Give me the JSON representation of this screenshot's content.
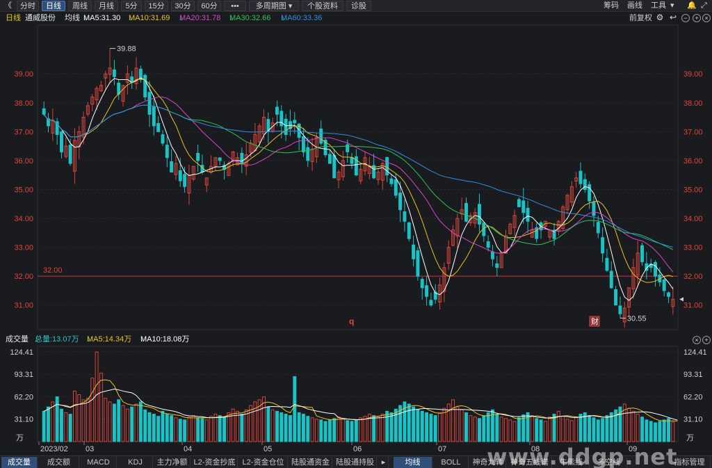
{
  "toolbar": {
    "back_icon": "《",
    "items": [
      "分时",
      "日线",
      "周线",
      "月线",
      "5分",
      "15分",
      "30分",
      "60分",
      "•••",
      "多周期图",
      "个股资料",
      "诊股"
    ],
    "active": "日线",
    "right": [
      "筹码",
      "画线",
      "工具"
    ],
    "dropdown_icon": "chevron-down-icon"
  },
  "legend": {
    "period": "日线",
    "name": "通威股份",
    "indicator": "均线",
    "ma5": "MA5:31.30",
    "ma10": "MA10:31.69",
    "ma20": "MA20:31.78",
    "ma30": "MA30:32.66",
    "ma60": "MA60:33.36",
    "adjust": "前复权",
    "arrow": "↓"
  },
  "colors": {
    "up": "#d9453a",
    "down": "#19c3c6",
    "ma5": "#ffffff",
    "ma10": "#e8c31f",
    "ma20": "#d846c8",
    "ma30": "#2ac45a",
    "ma60": "#2f8fe0",
    "grid": "#2c2d32",
    "axis_text": "#e0453a",
    "hline": "#c83a3a"
  },
  "price_axis": {
    "ticks": [
      "39.00",
      "38.00",
      "37.00",
      "36.00",
      "35.00",
      "34.00",
      "33.00",
      "32.00",
      "31.00"
    ],
    "min": 30.2,
    "max": 40.4
  },
  "annotations": {
    "high_label": "39.88",
    "low_label": "30.55",
    "hline_label": "32.00",
    "marker_q": "q",
    "marker_cai": "财"
  },
  "volume_legend": {
    "title": "成交量",
    "total": "总量:13.07万",
    "ma5": "MA5:14.34万",
    "ma10": "MA10:18.08万",
    "arrow": "↓"
  },
  "volume_axis": {
    "ticks": [
      "124.41",
      "93.31",
      "62.20",
      "31.10"
    ],
    "unit": "万",
    "max": 130
  },
  "date_axis": {
    "labels": [
      "2023/02",
      "03",
      "04",
      "05",
      "06",
      "07",
      "08",
      "09"
    ]
  },
  "bottom_tabs": {
    "left": [
      "成交量",
      "成交额",
      "MACD",
      "KDJ",
      "主力净额",
      "L2-资金抄底",
      "L2-资金仓位",
      "陆股通资金",
      "陆股通持股"
    ],
    "right": [
      "均线",
      "BOLL",
      "神奇九转",
      "神奇五线谱",
      "牛熊线",
      "多空线"
    ],
    "end": "指标管理",
    "active_left": "成交量",
    "active_right": "均线"
  },
  "watermark": "www.ddgp.net",
  "chart_data": {
    "type": "candlestick",
    "title": "通威股份 日线",
    "x_range": [
      "2023/02",
      "2023/09"
    ],
    "y_range": [
      30.55,
      39.88
    ],
    "price_high": 39.88,
    "price_low": 30.55,
    "last_close": 31.2,
    "moving_averages": {
      "MA5": 31.3,
      "MA10": 31.69,
      "MA20": 31.78,
      "MA30": 32.66,
      "MA60": 33.36
    },
    "volume": {
      "unit": "万",
      "total": 13.07,
      "MA5": 14.34,
      "MA10": 18.08
    },
    "closes_approx": [
      37.6,
      37.2,
      37.4,
      36.9,
      36.3,
      36.5,
      35.9,
      36.7,
      37.0,
      37.5,
      37.9,
      38.2,
      38.5,
      38.6,
      39.0,
      39.2,
      38.9,
      38.3,
      38.6,
      39.0,
      38.7,
      39.2,
      38.8,
      38.2,
      37.6,
      37.2,
      37.0,
      36.6,
      36.1,
      35.6,
      35.9,
      35.3,
      35.1,
      35.5,
      35.8,
      36.0,
      35.6,
      35.4,
      35.8,
      36.1,
      36.0,
      35.7,
      35.9,
      36.3,
      36.1,
      35.9,
      36.2,
      36.6,
      36.9,
      37.2,
      37.5,
      37.0,
      37.3,
      37.6,
      37.2,
      36.9,
      37.1,
      37.3,
      36.8,
      36.3,
      36.0,
      36.4,
      36.8,
      36.6,
      36.2,
      35.9,
      35.4,
      35.6,
      36.0,
      36.3,
      35.9,
      35.5,
      35.7,
      36.1,
      35.8,
      35.4,
      35.6,
      35.9,
      35.5,
      35.2,
      34.8,
      34.3,
      33.9,
      33.3,
      32.6,
      32.0,
      31.6,
      31.3,
      31.0,
      31.2,
      31.7,
      32.3,
      33.0,
      33.6,
      34.0,
      34.3,
      33.9,
      34.1,
      34.2,
      33.8,
      33.4,
      33.0,
      32.6,
      32.3,
      32.8,
      33.4,
      33.8,
      34.1,
      34.4,
      34.2,
      33.9,
      33.6,
      33.3,
      33.6,
      33.9,
      33.6,
      33.3,
      33.9,
      34.4,
      34.8,
      35.1,
      35.4,
      35.2,
      35.0,
      34.6,
      34.1,
      33.5,
      32.8,
      32.2,
      31.6,
      31.0,
      30.7,
      30.9,
      31.6,
      32.3,
      32.8,
      32.5,
      32.2,
      32.3,
      32.0,
      31.8,
      31.5,
      31.3,
      31.2
    ],
    "volume_approx": [
      42,
      48,
      55,
      62,
      45,
      40,
      38,
      70,
      65,
      58,
      60,
      88,
      124,
      95,
      60,
      55,
      52,
      58,
      50,
      45,
      48,
      52,
      55,
      44,
      40,
      38,
      35,
      42,
      38,
      36,
      33,
      31,
      30,
      34,
      36,
      33,
      32,
      30,
      35,
      38,
      36,
      34,
      40,
      45,
      42,
      38,
      44,
      50,
      55,
      58,
      62,
      48,
      44,
      42,
      40,
      38,
      36,
      90,
      40,
      38,
      35,
      33,
      31,
      30,
      28,
      30,
      32,
      34,
      31,
      29,
      28,
      30,
      33,
      35,
      38,
      36,
      34,
      38,
      42,
      40,
      45,
      50,
      55,
      52,
      48,
      44,
      42,
      40,
      38,
      36,
      40,
      46,
      52,
      58,
      48,
      44,
      40,
      36,
      34,
      32,
      36,
      40,
      44,
      38,
      34,
      32,
      30,
      28,
      33,
      37,
      40,
      36,
      32,
      30,
      28,
      34,
      38,
      42,
      35,
      31,
      29,
      34,
      38,
      40,
      36,
      33,
      30,
      32,
      36,
      40,
      44,
      48,
      52,
      46,
      42,
      38,
      34,
      30,
      28,
      26,
      28,
      30,
      32,
      27,
      25
    ]
  }
}
